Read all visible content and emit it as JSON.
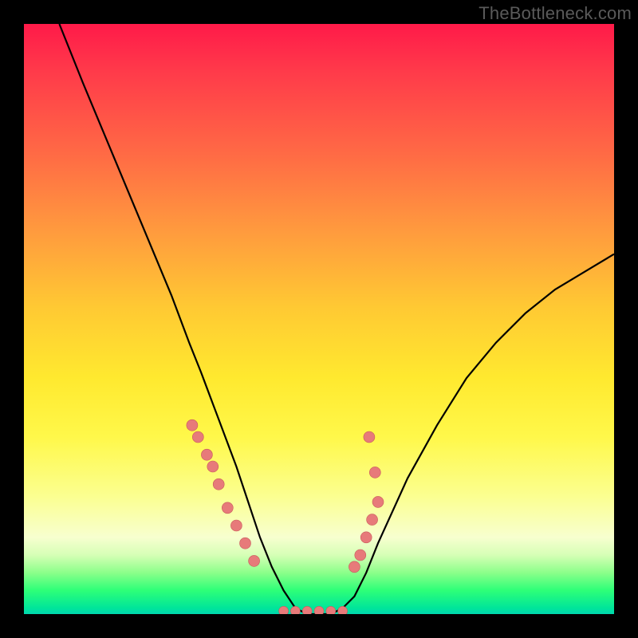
{
  "watermark": "TheBottleneck.com",
  "chart_data": {
    "type": "line",
    "title": "",
    "xlabel": "",
    "ylabel": "",
    "xlim": [
      0,
      100
    ],
    "ylim": [
      0,
      100
    ],
    "series": [
      {
        "name": "bottleneck-curve",
        "x": [
          6,
          10,
          15,
          20,
          25,
          28,
          30,
          33,
          36,
          38,
          40,
          42,
          44,
          46,
          48,
          50,
          52,
          54,
          56,
          58,
          60,
          65,
          70,
          75,
          80,
          85,
          90,
          95,
          100
        ],
        "y": [
          100,
          90,
          78,
          66,
          54,
          46,
          41,
          33,
          25,
          19,
          13,
          8,
          4,
          1,
          0,
          0,
          0,
          1,
          3,
          7,
          12,
          23,
          32,
          40,
          46,
          51,
          55,
          58,
          61
        ]
      }
    ],
    "flat_bottom": {
      "x_start": 44,
      "x_end": 54,
      "y": 0
    },
    "dots_left": [
      {
        "x": 28.5,
        "y": 32
      },
      {
        "x": 29.5,
        "y": 30
      },
      {
        "x": 31.0,
        "y": 27
      },
      {
        "x": 32.0,
        "y": 25
      },
      {
        "x": 33.0,
        "y": 22
      },
      {
        "x": 34.5,
        "y": 18
      },
      {
        "x": 36.0,
        "y": 15
      },
      {
        "x": 37.5,
        "y": 12
      },
      {
        "x": 39.0,
        "y": 9
      }
    ],
    "dots_right": [
      {
        "x": 56.0,
        "y": 8
      },
      {
        "x": 57.0,
        "y": 10
      },
      {
        "x": 58.0,
        "y": 13
      },
      {
        "x": 59.0,
        "y": 16
      },
      {
        "x": 60.0,
        "y": 19
      },
      {
        "x": 59.5,
        "y": 24
      },
      {
        "x": 58.5,
        "y": 30
      }
    ],
    "dots_bottom": [
      {
        "x": 44,
        "y": 0.5
      },
      {
        "x": 46,
        "y": 0.5
      },
      {
        "x": 48,
        "y": 0.5
      },
      {
        "x": 50,
        "y": 0.5
      },
      {
        "x": 52,
        "y": 0.5
      },
      {
        "x": 54,
        "y": 0.5
      }
    ],
    "colors": {
      "curve": "#000000",
      "dot_fill": "#e77a7a",
      "dot_stroke": "#c85a5a"
    }
  }
}
